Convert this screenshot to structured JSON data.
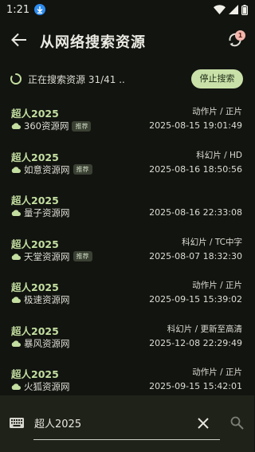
{
  "status_bar": {
    "time": "1:21",
    "icons": [
      "download-icon",
      "wifi-icon",
      "signal-icon",
      "battery-icon"
    ]
  },
  "app_bar": {
    "title": "从网络搜索资源",
    "sync_badge_count": "1"
  },
  "progress": {
    "text": "正在搜索资源 31/41 ..",
    "stop_label": "停止搜索"
  },
  "results": [
    {
      "title": "超人2025",
      "meta": "动作片 / 正片",
      "source": "360资源网",
      "recommended": true,
      "time": "2025-08-15 19:01:49"
    },
    {
      "title": "超人2025",
      "meta": "科幻片 / HD",
      "source": "如意资源网",
      "recommended": true,
      "time": "2025-08-16 18:50:56"
    },
    {
      "title": "超人2025",
      "meta": "",
      "source": "量子资源网",
      "recommended": false,
      "time": "2025-08-16 22:33:08"
    },
    {
      "title": "超人2025",
      "meta": "科幻片 / TC中字",
      "source": "天堂资源网",
      "recommended": true,
      "time": "2025-08-07 18:32:30"
    },
    {
      "title": "超人2025",
      "meta": "动作片 / 正片",
      "source": "极速资源网",
      "recommended": false,
      "time": "2025-09-15 15:39:02"
    },
    {
      "title": "超人2025",
      "meta": "科幻片 / 更新至高清",
      "source": "暴风资源网",
      "recommended": false,
      "time": "2025-12-08 22:29:49"
    },
    {
      "title": "超人2025",
      "meta": "动作片 / 正片",
      "source": "火狐资源网",
      "recommended": false,
      "time": "2025-09-15 15:42:01"
    }
  ],
  "recommended_label": "推荐",
  "search": {
    "value": "超人2025"
  },
  "colors": {
    "background": "#121410",
    "accent_green": "#c3dea0",
    "stop_button": "#c9e1a8",
    "badge": "#f3b6ad"
  }
}
